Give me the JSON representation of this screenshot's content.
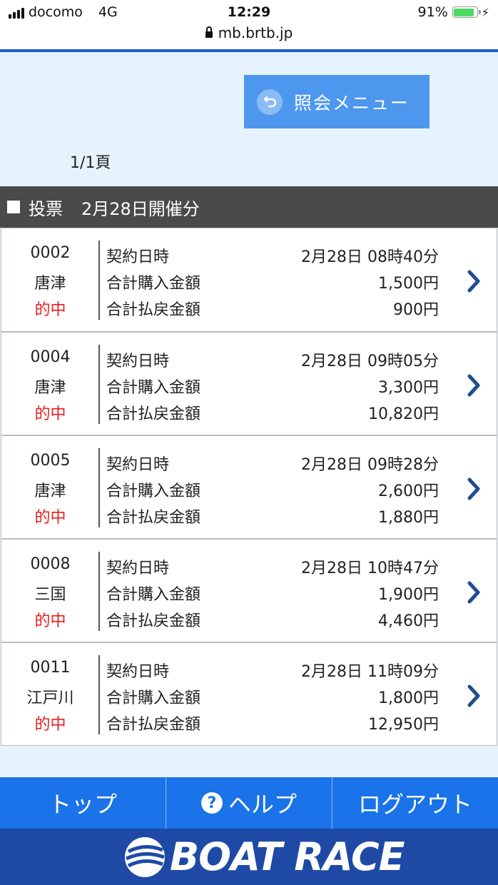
{
  "status_bar": {
    "carrier": "docomo",
    "network": "4G",
    "time": "12:29",
    "battery": "91%",
    "battery_level": 0.91,
    "url": "mb.brtb.jp"
  },
  "menu_button": {
    "label": "照会メニュー"
  },
  "page_indicator": "1/1頁",
  "section": {
    "title": "投票",
    "date": "2月28日開催分"
  },
  "labels": {
    "contract_time": "契約日時",
    "total_purchase": "合計購入金額",
    "total_refund": "合計払戻金額"
  },
  "records": [
    {
      "number": "0002",
      "venue": "唐津",
      "result": "的中",
      "contract_time": "2月28日 08時40分",
      "purchase": "1,500円",
      "refund": "900円"
    },
    {
      "number": "0004",
      "venue": "唐津",
      "result": "的中",
      "contract_time": "2月28日 09時05分",
      "purchase": "3,300円",
      "refund": "10,820円"
    },
    {
      "number": "0005",
      "venue": "唐津",
      "result": "的中",
      "contract_time": "2月28日 09時28分",
      "purchase": "2,600円",
      "refund": "1,880円"
    },
    {
      "number": "0008",
      "venue": "三国",
      "result": "的中",
      "contract_time": "2月28日 10時47分",
      "purchase": "1,900円",
      "refund": "4,460円"
    },
    {
      "number": "0011",
      "venue": "江戸川",
      "result": "的中",
      "contract_time": "2月28日 11時09分",
      "purchase": "1,800円",
      "refund": "12,950円"
    }
  ],
  "bottom_nav": {
    "top": "トップ",
    "help": "ヘルプ",
    "logout": "ログアウト"
  },
  "brand": {
    "name": "BOAT RACE"
  },
  "colors": {
    "accent": "#1a73e8",
    "hit": "#e51f1f",
    "brand": "#1e4aa6",
    "menu_button": "#4d97ee"
  }
}
